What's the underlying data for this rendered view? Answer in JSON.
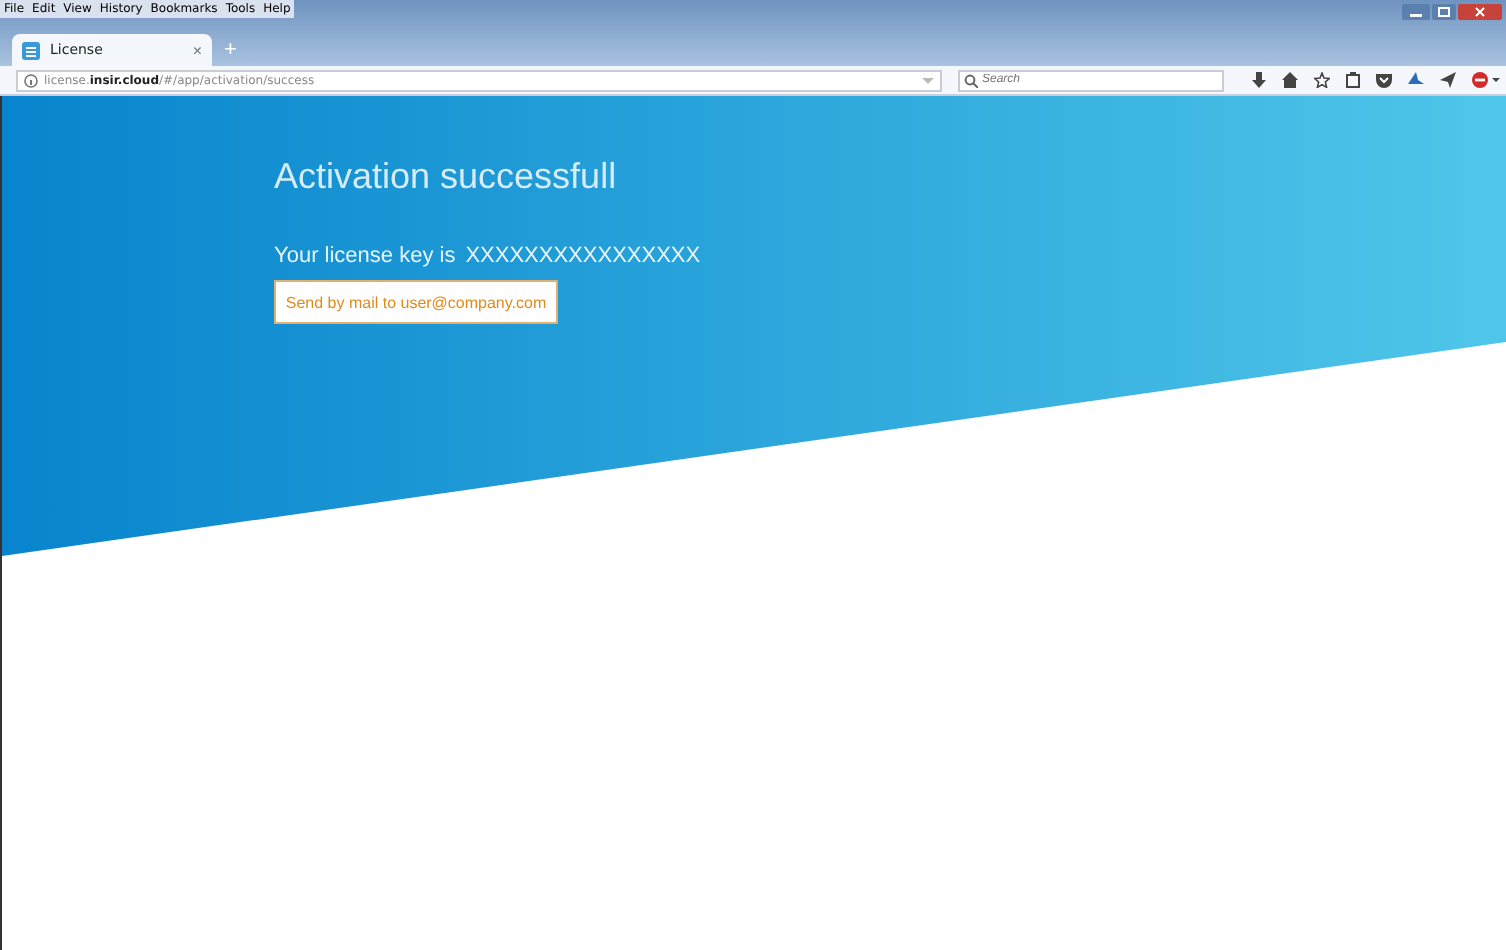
{
  "menu": [
    "File",
    "Edit",
    "View",
    "History",
    "Bookmarks",
    "Tools",
    "Help"
  ],
  "tabs": [
    {
      "label": "License",
      "selected": true,
      "close": "×"
    }
  ],
  "new_tab": "+",
  "address": {
    "url": "license.**insir.cloud**/#/app/activation/success"
  },
  "search": {
    "placeholder": "Search"
  },
  "page": {
    "title": "Activation successfull",
    "key_label": "Your license key is",
    "key": "XXXXXXXXXXXXXXXX",
    "button": "Send by mail to user@company.com"
  }
}
